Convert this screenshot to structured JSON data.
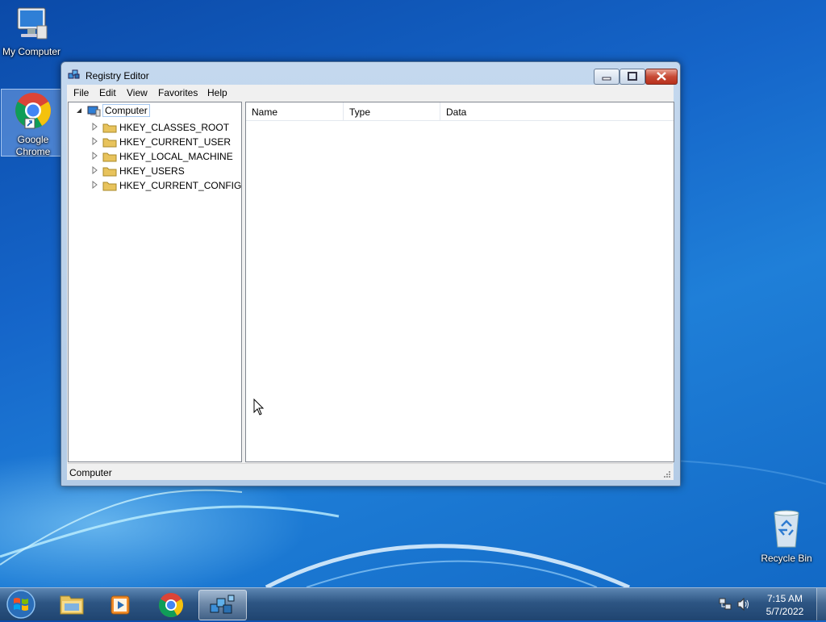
{
  "desktop": {
    "icons": [
      {
        "label": "My Computer"
      },
      {
        "label": "Google Chrome"
      },
      {
        "label": "Recycle Bin"
      }
    ]
  },
  "window": {
    "title": "Registry Editor",
    "menu": [
      "File",
      "Edit",
      "View",
      "Favorites",
      "Help"
    ],
    "tree": {
      "root": "Computer",
      "children": [
        "HKEY_CLASSES_ROOT",
        "HKEY_CURRENT_USER",
        "HKEY_LOCAL_MACHINE",
        "HKEY_USERS",
        "HKEY_CURRENT_CONFIG"
      ]
    },
    "columns": [
      "Name",
      "Type",
      "Data"
    ],
    "status": "Computer"
  },
  "taskbar": {
    "time": "7:15 AM",
    "date": "5/7/2022",
    "pinned": [
      "windows-explorer",
      "media-player",
      "google-chrome",
      "registry-editor"
    ]
  },
  "colors": {
    "desktop": "#1565c9",
    "taskbar": "#2d5583",
    "close_button": "#c74a35"
  }
}
